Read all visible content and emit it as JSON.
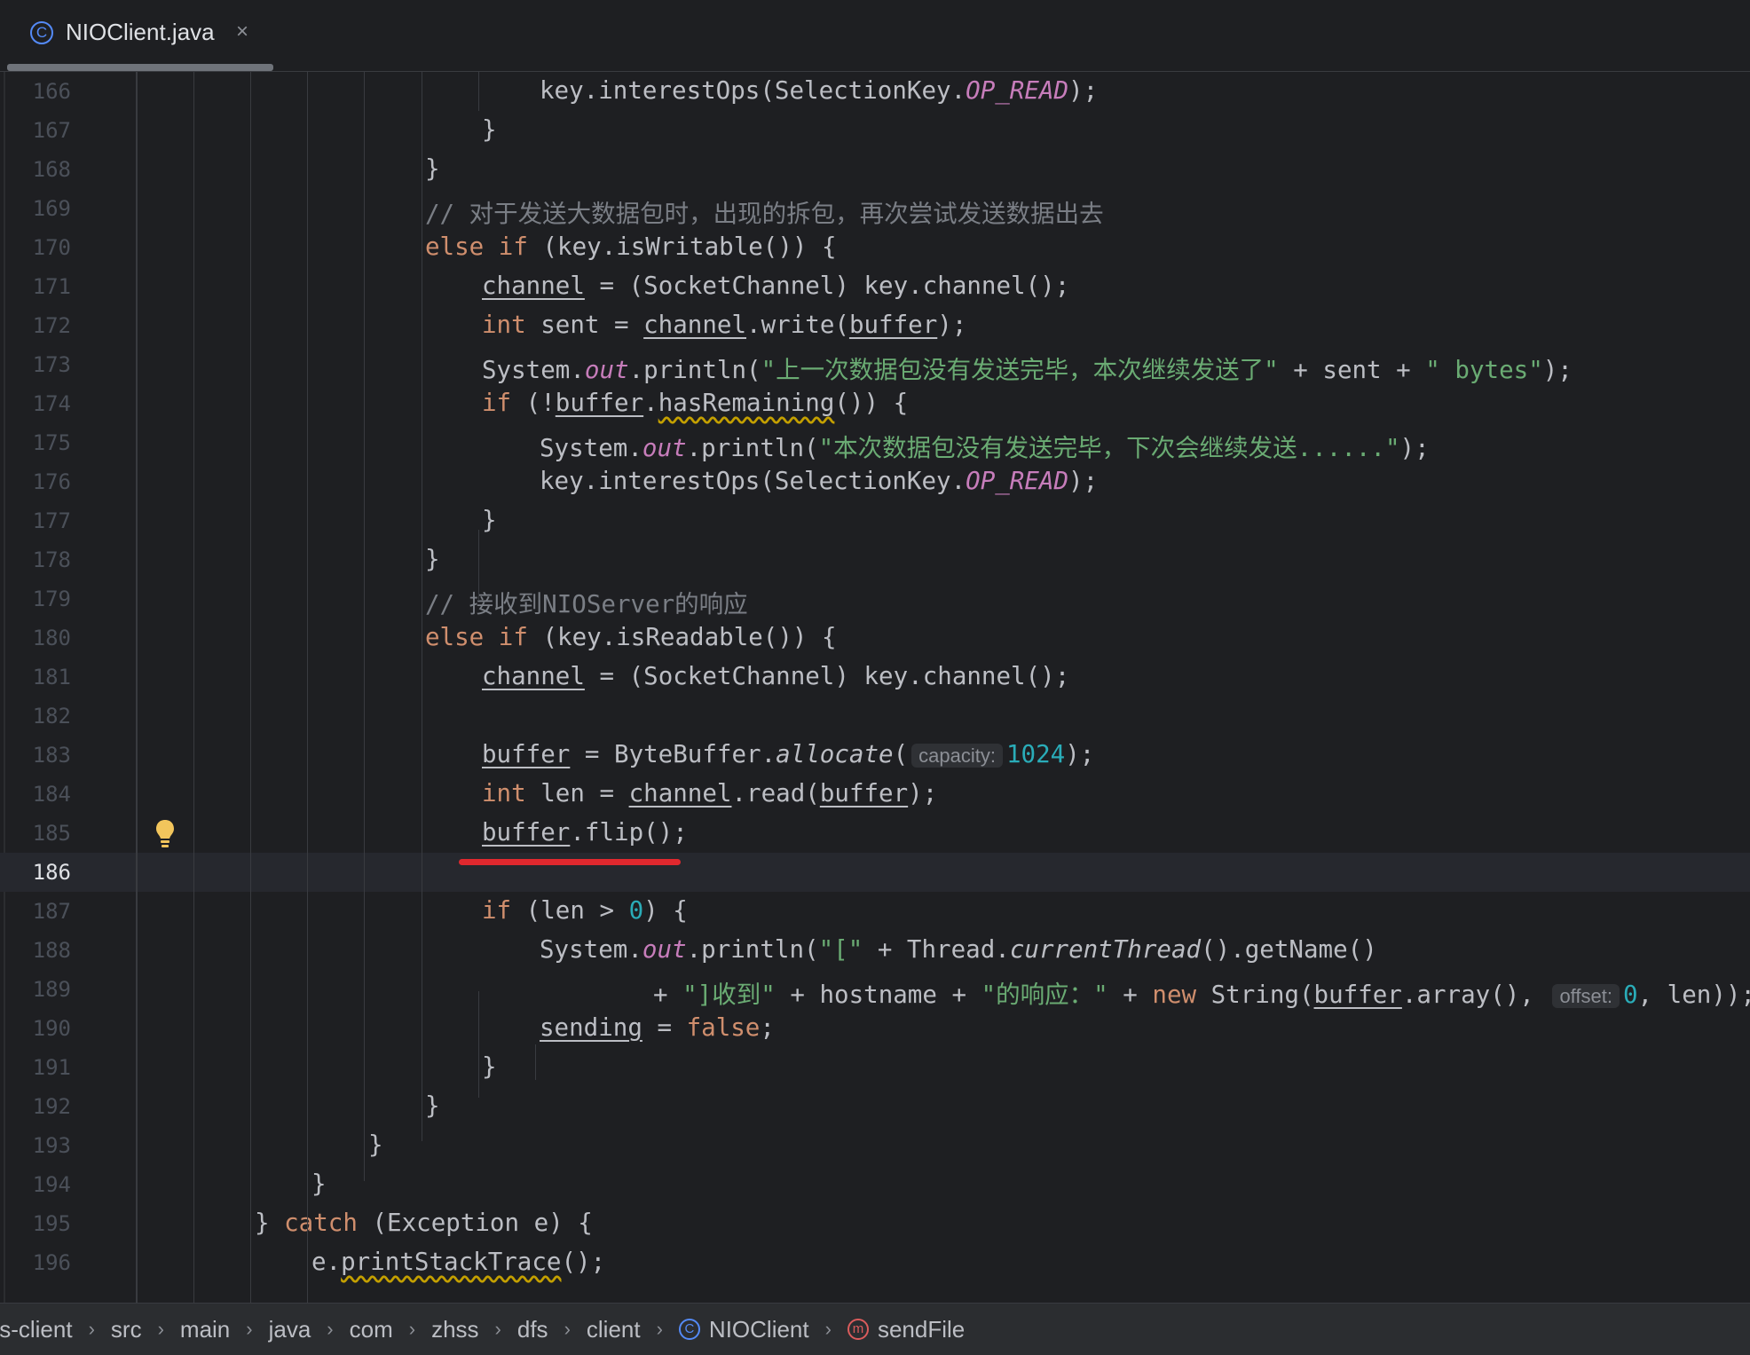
{
  "tab": {
    "title": "NIOClient.java",
    "icon": "class-icon",
    "close_glyph": "×"
  },
  "editor": {
    "current_line": 186,
    "lines": [
      {
        "n": "166",
        "indent": 0,
        "tokens": [
          [
            "plain",
            "key.interestOps(SelectionKey."
          ],
          [
            "const",
            "OP_READ"
          ],
          [
            "plain",
            ");"
          ]
        ]
      },
      {
        "n": "167",
        "indent": 0,
        "tokens": [
          [
            "plain",
            "}"
          ]
        ]
      },
      {
        "n": "168",
        "indent": 0,
        "tokens": [
          [
            "plain",
            "}"
          ]
        ]
      },
      {
        "n": "169",
        "indent": 0,
        "tokens": [
          [
            "comment",
            "// 对于发送大数据包时，出现的拆包，再次尝试发送数据出去"
          ]
        ]
      },
      {
        "n": "170",
        "indent": 0,
        "tokens": [
          [
            "kw",
            "else if"
          ],
          [
            "plain",
            " (key.isWritable()) {"
          ]
        ]
      },
      {
        "n": "171",
        "indent": 0,
        "tokens": [
          [
            "var",
            "channel"
          ],
          [
            "plain",
            " = (SocketChannel) key.channel();"
          ]
        ]
      },
      {
        "n": "172",
        "indent": 0,
        "tokens": [
          [
            "kw",
            "int"
          ],
          [
            "plain",
            " sent = "
          ],
          [
            "var",
            "channel"
          ],
          [
            "plain",
            ".write("
          ],
          [
            "var",
            "buffer"
          ],
          [
            "plain",
            ");"
          ]
        ]
      },
      {
        "n": "173",
        "indent": 0,
        "tokens": [
          [
            "plain",
            "System."
          ],
          [
            "field",
            "out"
          ],
          [
            "plain",
            ".println("
          ],
          [
            "str",
            "\"上一次数据包没有发送完毕，本次继续发送了\""
          ],
          [
            "plain",
            " + sent + "
          ],
          [
            "str",
            "\" bytes\""
          ],
          [
            "plain",
            ");"
          ]
        ]
      },
      {
        "n": "174",
        "indent": 0,
        "tokens": [
          [
            "kw",
            "if"
          ],
          [
            "plain",
            " (!"
          ],
          [
            "var",
            "buffer"
          ],
          [
            "plain",
            "."
          ],
          [
            "warn",
            "hasRemaining"
          ],
          [
            "plain",
            "()) {"
          ]
        ]
      },
      {
        "n": "175",
        "indent": 0,
        "tokens": [
          [
            "plain",
            "System."
          ],
          [
            "field",
            "out"
          ],
          [
            "plain",
            ".println("
          ],
          [
            "str",
            "\"本次数据包没有发送完毕，下次会继续发送......\""
          ],
          [
            "plain",
            ");"
          ]
        ]
      },
      {
        "n": "176",
        "indent": 0,
        "tokens": [
          [
            "plain",
            "key.interestOps(SelectionKey."
          ],
          [
            "const",
            "OP_READ"
          ],
          [
            "plain",
            ");"
          ]
        ]
      },
      {
        "n": "177",
        "indent": 0,
        "tokens": [
          [
            "plain",
            "}"
          ]
        ]
      },
      {
        "n": "178",
        "indent": 0,
        "tokens": [
          [
            "plain",
            "}"
          ]
        ]
      },
      {
        "n": "179",
        "indent": 0,
        "tokens": [
          [
            "comment",
            "// 接收到NIOServer的响应"
          ]
        ]
      },
      {
        "n": "180",
        "indent": 0,
        "tokens": [
          [
            "kw",
            "else if"
          ],
          [
            "plain",
            " (key.isReadable()) {"
          ]
        ]
      },
      {
        "n": "181",
        "indent": 0,
        "tokens": [
          [
            "var",
            "channel"
          ],
          [
            "plain",
            " = (SocketChannel) key.channel();"
          ]
        ]
      },
      {
        "n": "182",
        "indent": 0,
        "tokens": []
      },
      {
        "n": "183",
        "indent": 0,
        "tokens": [
          [
            "var",
            "buffer"
          ],
          [
            "plain",
            " = ByteBuffer."
          ],
          [
            "static",
            "allocate"
          ],
          [
            "plain",
            "("
          ],
          [
            "hint",
            "capacity:"
          ],
          [
            "num",
            "1024"
          ],
          [
            "plain",
            ");"
          ]
        ]
      },
      {
        "n": "184",
        "indent": 0,
        "tokens": [
          [
            "kw",
            "int"
          ],
          [
            "plain",
            " len = "
          ],
          [
            "var",
            "channel"
          ],
          [
            "plain",
            ".read("
          ],
          [
            "var",
            "buffer"
          ],
          [
            "plain",
            ");"
          ]
        ]
      },
      {
        "n": "185",
        "indent": 0,
        "tokens": [
          [
            "var",
            "buffer"
          ],
          [
            "plain",
            ".flip();"
          ]
        ]
      },
      {
        "n": "186",
        "indent": 0,
        "tokens": []
      },
      {
        "n": "187",
        "indent": 0,
        "tokens": [
          [
            "kw",
            "if"
          ],
          [
            "plain",
            " (len > "
          ],
          [
            "num",
            "0"
          ],
          [
            "plain",
            ") {"
          ]
        ]
      },
      {
        "n": "188",
        "indent": 0,
        "tokens": [
          [
            "plain",
            "System."
          ],
          [
            "field",
            "out"
          ],
          [
            "plain",
            ".println("
          ],
          [
            "str",
            "\"[\""
          ],
          [
            "plain",
            " + Thread."
          ],
          [
            "static",
            "currentThread"
          ],
          [
            "plain",
            "().getName()"
          ]
        ]
      },
      {
        "n": "189",
        "indent": 0,
        "tokens": [
          [
            "plain",
            "+ "
          ],
          [
            "str",
            "\"]收到\""
          ],
          [
            "plain",
            " + hostname + "
          ],
          [
            "str",
            "\"的响应：\""
          ],
          [
            "plain",
            " + "
          ],
          [
            "kw",
            "new"
          ],
          [
            "plain",
            " String("
          ],
          [
            "var",
            "buffer"
          ],
          [
            "plain",
            ".array(), "
          ],
          [
            "hint",
            "offset:"
          ],
          [
            "num",
            "0"
          ],
          [
            "plain",
            ", len));"
          ]
        ]
      },
      {
        "n": "190",
        "indent": 0,
        "tokens": [
          [
            "var",
            "sending"
          ],
          [
            "plain",
            " = "
          ],
          [
            "kw",
            "false"
          ],
          [
            "plain",
            ";"
          ]
        ]
      },
      {
        "n": "191",
        "indent": 0,
        "tokens": [
          [
            "plain",
            "}"
          ]
        ]
      },
      {
        "n": "192",
        "indent": 0,
        "tokens": [
          [
            "plain",
            "}"
          ]
        ]
      },
      {
        "n": "193",
        "indent": 0,
        "tokens": [
          [
            "plain",
            "}"
          ]
        ]
      },
      {
        "n": "194",
        "indent": 0,
        "tokens": [
          [
            "plain",
            "}"
          ]
        ]
      },
      {
        "n": "195",
        "indent": 0,
        "tokens": [
          [
            "plain",
            "} "
          ],
          [
            "kw",
            "catch"
          ],
          [
            "plain",
            " (Exception e) {"
          ]
        ]
      },
      {
        "n": "196",
        "indent": 0,
        "tokens": [
          [
            "plain",
            "e."
          ],
          [
            "warn",
            "printStackTrace"
          ],
          [
            "plain",
            "();"
          ]
        ]
      }
    ]
  },
  "colors": {
    "background": "#1e1f22",
    "keyword": "#cf8e6d",
    "string": "#6aab73",
    "number": "#2aacb8",
    "comment": "#7a7e85",
    "constant": "#c77dbb",
    "accent_blue": "#548af7",
    "method_icon": "#db5c5c",
    "annotation_red": "#e0282e"
  },
  "breadcrumbs": [
    {
      "label": "fs-client",
      "icon": ""
    },
    {
      "label": "src",
      "icon": ""
    },
    {
      "label": "main",
      "icon": ""
    },
    {
      "label": "java",
      "icon": ""
    },
    {
      "label": "com",
      "icon": ""
    },
    {
      "label": "zhss",
      "icon": ""
    },
    {
      "label": "dfs",
      "icon": ""
    },
    {
      "label": "client",
      "icon": ""
    },
    {
      "label": "NIOClient",
      "icon": "class-icon"
    },
    {
      "label": "sendFile",
      "icon": "method-icon"
    }
  ],
  "icons": {
    "class": "C",
    "method": "m",
    "breadcrumb_separator": "›"
  }
}
